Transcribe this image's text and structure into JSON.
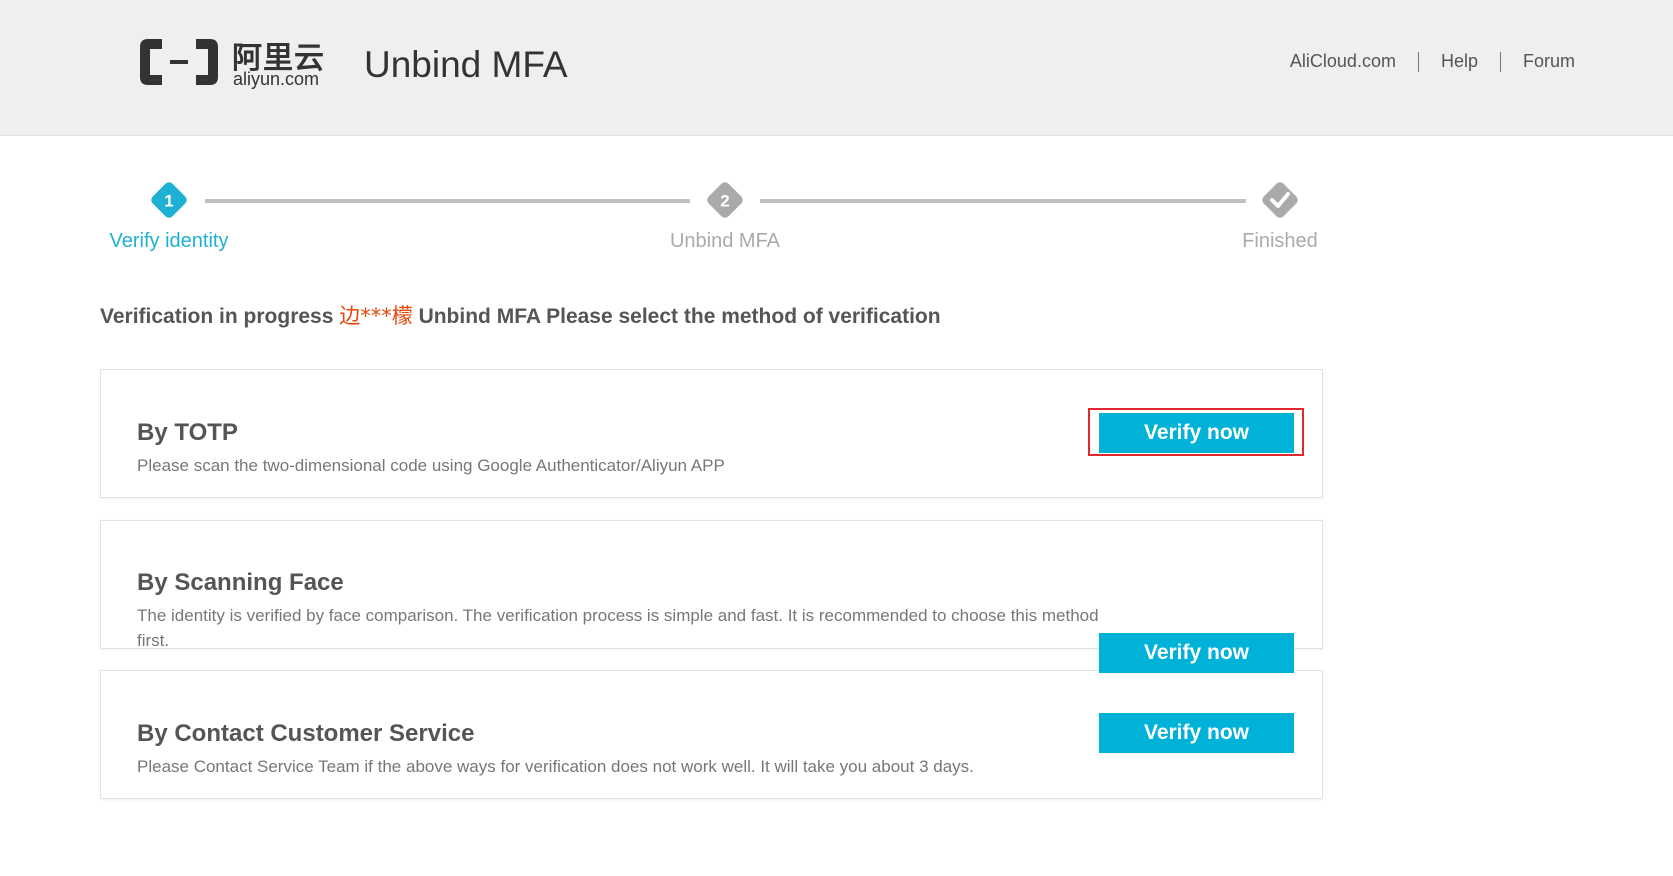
{
  "header": {
    "logo_cn": "阿里云",
    "logo_en": "aliyun.com",
    "title": "Unbind MFA",
    "nav": [
      "AliCloud.com",
      "Help",
      "Forum"
    ]
  },
  "steps": [
    {
      "number": "1",
      "label": "Verify identity",
      "state": "active"
    },
    {
      "number": "2",
      "label": "Unbind MFA",
      "state": "pending"
    },
    {
      "icon": "check-icon",
      "label": "Finished",
      "state": "pending"
    }
  ],
  "prompt": {
    "lead": "Verification in progress ",
    "user": "边***檬",
    "tail": " Unbind MFA Please select the method of verification"
  },
  "methods": [
    {
      "title": "By TOTP",
      "description": "Please scan the two-dimensional code using Google Authenticator/Aliyun APP",
      "button": "Verify now"
    },
    {
      "title": "By Scanning Face",
      "description": "The identity is verified by face comparison. The verification process is simple and fast. It is recommended to choose this method first.",
      "button": "Verify now"
    },
    {
      "title": "By Contact Customer Service",
      "description": "Please Contact Service Team if the above ways for verification does not work well. It will take you about 3 days.",
      "button": "Verify now"
    }
  ],
  "colors": {
    "accent": "#00b2d8",
    "active_step": "#1eb1d4",
    "inactive_step": "#aaaaaa",
    "user_highlight": "#e8480c",
    "annotation_box": "#e0282e"
  }
}
